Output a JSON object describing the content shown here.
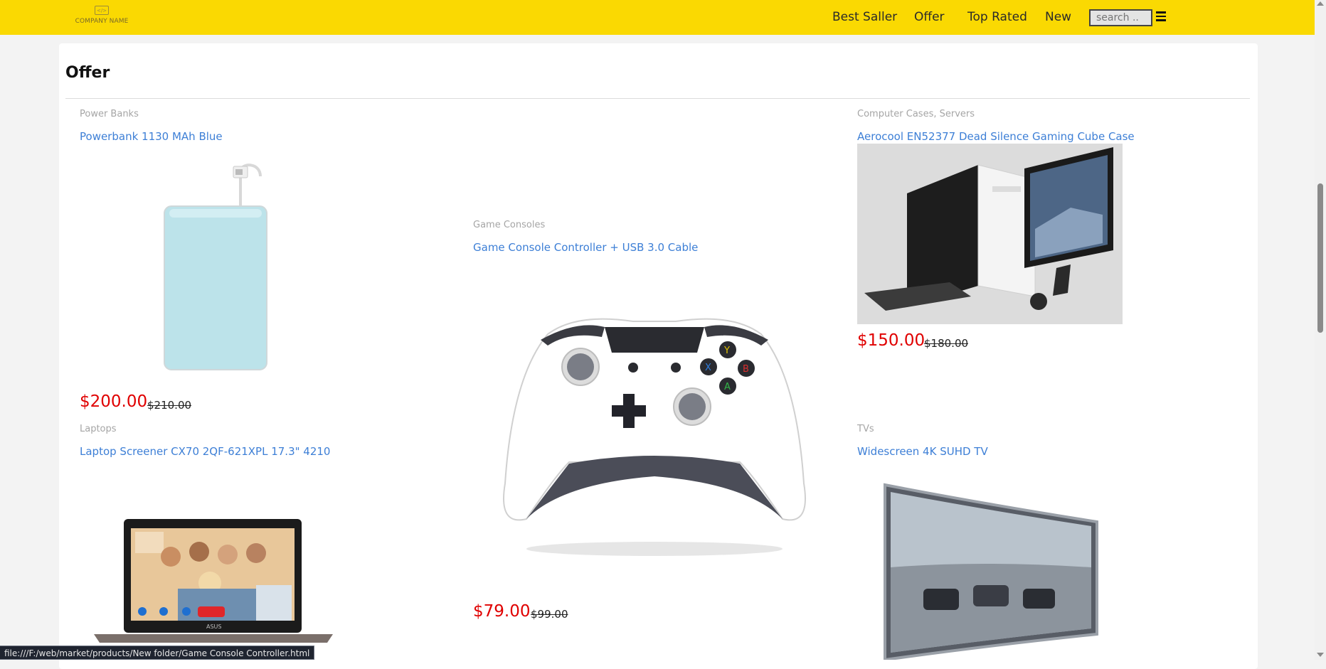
{
  "header": {
    "logo_text": "COMPANY NAME",
    "logo_icon_glyph": "</>",
    "nav": [
      "Best Saller",
      "Offer",
      "Top Rated",
      "New"
    ],
    "search_placeholder": "search .."
  },
  "section": {
    "title": "Offer"
  },
  "products": [
    {
      "category": "Power Banks",
      "name": "Powerbank 1130 MAh Blue",
      "price": "$200.00",
      "old_price": "$210.00"
    },
    {
      "category": "Game Consoles",
      "name": "Game Console Controller + USB 3.0 Cable",
      "price": "$79.00",
      "old_price": "$99.00"
    },
    {
      "category": "Computer Cases, Servers",
      "name": "Aerocool EN52377 Dead Silence Gaming Cube Case",
      "price": "$150.00",
      "old_price": "$180.00"
    },
    {
      "category": "Laptops",
      "name": "Laptop Screener CX70 2QF-621XPL 17.3\" 4210",
      "price": "",
      "old_price": ""
    },
    {
      "category": "TVs",
      "name": "Widescreen 4K SUHD TV",
      "price": "",
      "old_price": ""
    }
  ],
  "status_url": "file:///F:/web/market/products/New folder/Game Console Controller.html",
  "colors": {
    "topbar": "#fad902",
    "price": "#e00000",
    "link": "#3d7fd6"
  }
}
